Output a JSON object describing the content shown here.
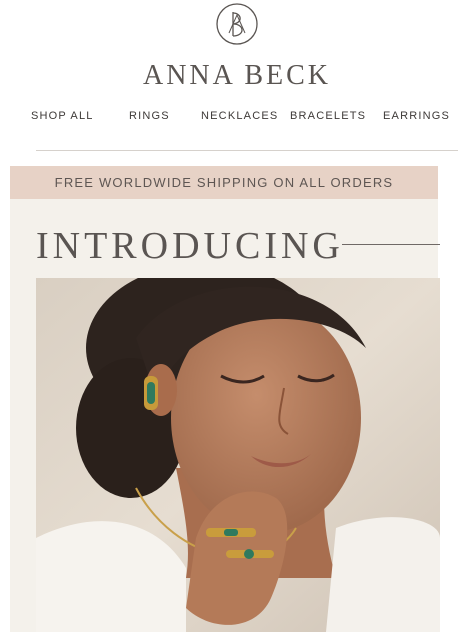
{
  "brand": {
    "name": "ANNA BECK",
    "logo_icon": "ab-monogram-logo-icon"
  },
  "nav": {
    "items": [
      {
        "label": "SHOP ALL"
      },
      {
        "label": "RINGS"
      },
      {
        "label": "NECKLACES"
      },
      {
        "label": "BRACELETS"
      },
      {
        "label": "EARRINGS"
      }
    ]
  },
  "promo": {
    "shipping_text": "FREE WORLDWIDE SHIPPING ON ALL ORDERS"
  },
  "hero": {
    "heading": "INTRODUCING",
    "image_subject": "model-wearing-gold-jewelry"
  },
  "colors": {
    "promo_bar": "#e7d2c6",
    "panel_bg": "#f4f1eb",
    "text": "#4a4542"
  }
}
